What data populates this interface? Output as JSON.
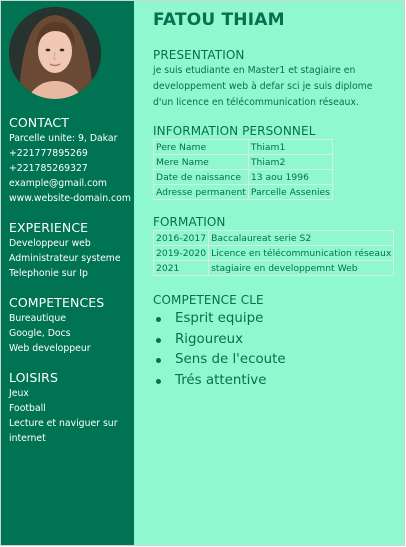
{
  "sidebar": {
    "contact_title": "CONTACT",
    "contact": [
      "Parcelle unite: 9, Dakar",
      "+221777895269",
      "+221785269327",
      "example@gmail.com",
      "www.website-domain.com"
    ],
    "experience_title": "EXPERIENCE",
    "experience": [
      "Developpeur web",
      "Administrateur systeme",
      "Telephonie sur Ip"
    ],
    "competences_title": "COMPETENCES",
    "competences": [
      "Bureautique",
      "Google, Docs",
      "Web developpeur"
    ],
    "loisirs_title": "LOISIRS",
    "loisirs": [
      "Jeux",
      "Football",
      "Lecture et naviguer sur internet"
    ]
  },
  "main": {
    "name": "FATOU THIAM",
    "presentation_title": "PRESENTATION",
    "presentation_text": "je suis etudiante en Master1 et stagiaire en developpement web à defar sci je suis diplome d'un licence en télécommunication réseaux.",
    "info_title": "INFORMATION PERSONNEL",
    "info_rows": [
      [
        "Pere Name",
        "Thiam1"
      ],
      [
        "Mere Name",
        "Thiam2"
      ],
      [
        "Date de naissance",
        "13 aou 1996"
      ],
      [
        "Adresse permanent",
        "Parcelle Assenies"
      ]
    ],
    "formation_title": "FORMATION",
    "formation_rows": [
      [
        "2016-2017",
        "Baccalaureat serie S2"
      ],
      [
        "2019-2020",
        "Licence en télécommunication réseaux"
      ],
      [
        "2021",
        "stagiaire en developpemnt Web"
      ]
    ],
    "competence_title": "COMPETENCE CLE",
    "competence_items": [
      "Esprit equipe",
      "Rigoureux",
      "Sens de l'ecoute",
      "Trés attentive"
    ]
  },
  "colors": {
    "sidebar_bg": "#007452",
    "main_bg": "#8ff8cf",
    "text_green": "#0a6e4f"
  }
}
